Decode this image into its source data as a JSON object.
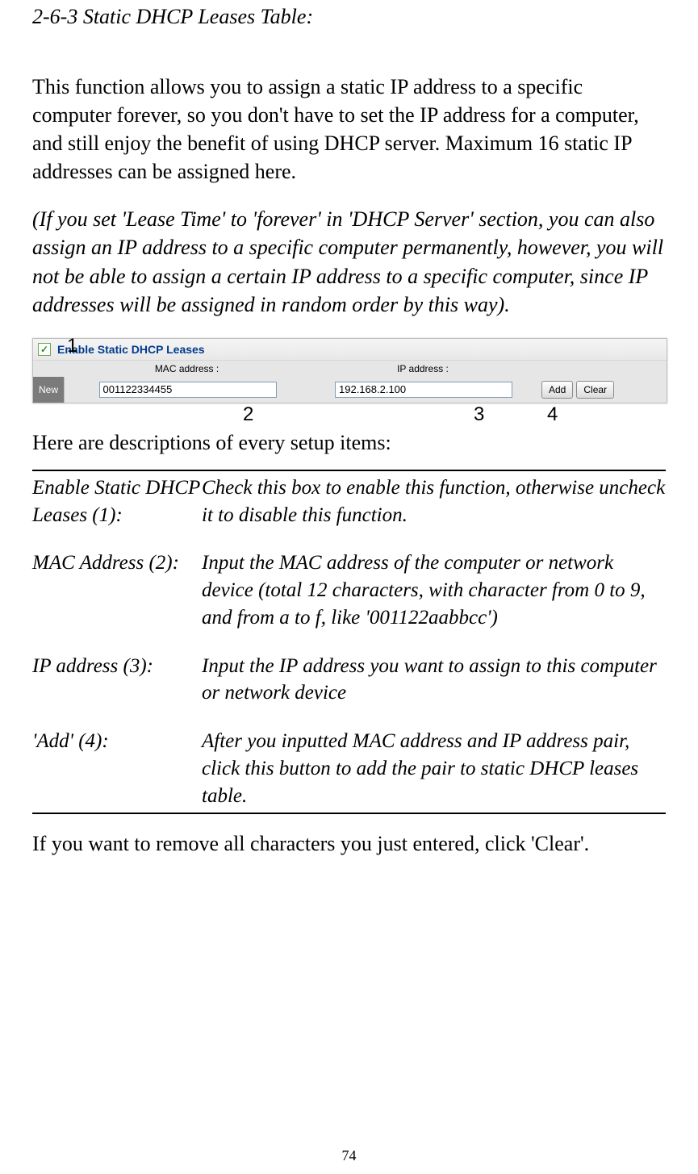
{
  "title": "2-6-3 Static DHCP Leases Table:",
  "para1": "This function allows you to assign a static IP address to a specific computer forever, so you don't have to set the IP address for a computer, and still enjoy the benefit of using DHCP server. Maximum 16 static IP addresses can be assigned here.",
  "para2": "(If you set 'Lease Time' to 'forever' in 'DHCP Server' section, you can also assign an IP address to a specific computer permanently, however, you will not be able to assign a certain IP address to a specific computer, since IP addresses will be assigned in random order by this way).",
  "callouts": {
    "c1": "1",
    "c2": "2",
    "c3": "3",
    "c4": "4"
  },
  "ui": {
    "checkbox_mark": "✓",
    "enable_label": "Enable Static DHCP Leases",
    "col_mac": "MAC address :",
    "col_ip": "IP address :",
    "new_label": "New",
    "mac_value": "001122334455",
    "ip_value": "192.168.2.100",
    "add_btn": "Add",
    "clear_btn": "Clear"
  },
  "desc_intro": "Here are descriptions of every setup items:",
  "rows": {
    "r1_label": "Enable Static DHCP Leases (1):",
    "r1_text": "Check this box to enable this function, otherwise uncheck it to disable this function.",
    "r2_label": "MAC Address (2):",
    "r2_text": "Input the MAC address of the computer or network device (total 12 characters, with character from 0 to 9, and from a to f, like '001122aabbcc')",
    "r3_label": "IP address (3):",
    "r3_text": "Input the IP address you want to assign to this computer or network device",
    "r4_label": "'Add' (4):",
    "r4_text": "After you inputted MAC address and IP address pair, click this button to add the pair to static DHCP leases table."
  },
  "footer": "If you want to remove all characters you just entered, click 'Clear'.",
  "page_number": "74"
}
